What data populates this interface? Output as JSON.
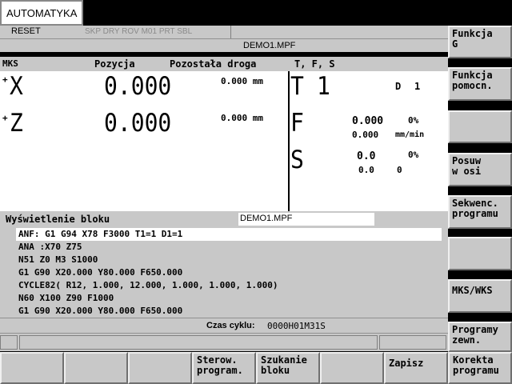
{
  "title_bar": {
    "mode": "AUTOMATYKA"
  },
  "status": {
    "reset": "RESET",
    "flags": "SKP DRY ROV M01 PRT SBL",
    "program": "DEMO1.MPF"
  },
  "axes_panel": {
    "mks_label": "MKS",
    "position_label": "Pozycja",
    "remaining_label": "Pozostała droga",
    "axes": [
      {
        "sign": "+",
        "name": "X",
        "position": "0.000",
        "remaining": "0.000 mm"
      },
      {
        "sign": "+",
        "name": "Z",
        "position": "0.000",
        "remaining": "0.000 mm"
      }
    ]
  },
  "tfs_panel": {
    "header": "T, F, S",
    "tool_letter": "T",
    "tool_number": "1",
    "d_label": "D",
    "d_value": "1",
    "feed_letter": "F",
    "feed_value": "0.000",
    "feed_pct": "0%",
    "feed_value2": "0.000",
    "feed_unit": "mm/min",
    "spindle_letter": "S",
    "spindle_value": "0.0",
    "spindle_pct": "0%",
    "spindle_value2": "0.0",
    "spindle_value3": "0"
  },
  "block_display": {
    "label": "Wyświetlenie bloku",
    "program": "DEMO1.MPF",
    "lines": [
      "ANF: G1 G94 X78 F3000 T1=1 D1=1",
      "ANA :X70 Z75",
      "N51 Z0 M3 S1000",
      "G1 G90 X20.000 Y80.000 F650.000",
      "CYCLE82( R12, 1.000, 12.000, 1.000, 1.000, 1.000)",
      "N60 X100 Z90 F1000",
      "G1 G90 X20.000 Y80.000 F650.000"
    ]
  },
  "cycle_time": {
    "label": "Czas cyklu:",
    "value": "0000H01M31S"
  },
  "vertical_softkeys": [
    "Funkcja\nG",
    "Funkcja\npomocn.",
    "",
    "Posuw\nw osi",
    "Sekwenc.\nprogramu",
    "",
    "MKS/WKS",
    "Programy\nzewn."
  ],
  "horizontal_softkeys": [
    "",
    "",
    "",
    "Sterow.\nprogram.",
    "Szukanie\nbloku",
    "",
    "Zapisz",
    "Korekta\nprogramu"
  ]
}
